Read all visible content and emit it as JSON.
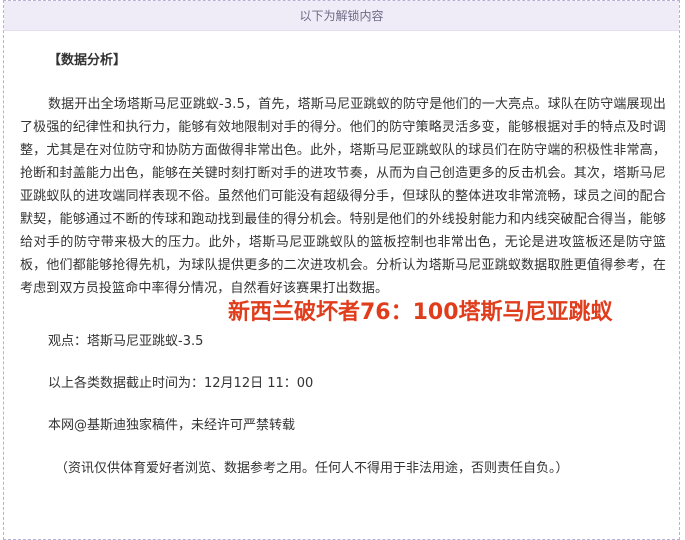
{
  "unlock_header": {
    "label": "以下为解锁内容"
  },
  "article": {
    "section_title": "【数据分析】",
    "paragraph": "数据开出全场塔斯马尼亚跳蚁-3.5，首先，塔斯马尼亚跳蚁的防守是他们的一大亮点。球队在防守端展现出了极强的纪律性和执行力，能够有效地限制对手的得分。他们的防守策略灵活多变，能够根据对手的特点及时调整，尤其是在对位防守和协防方面做得非常出色。此外，塔斯马尼亚跳蚁队的球员们在防守端的积极性非常高，抢断和封盖能力出色，能够在关键时刻打断对手的进攻节奏，从而为自己创造更多的反击机会。其次，塔斯马尼亚跳蚁队的进攻端同样表现不俗。虽然他们可能没有超级得分手，但球队的整体进攻非常流畅，球员之间的配合默契，能够通过不断的传球和跑动找到最佳的得分机会。特别是他们的外线投射能力和内线突破配合得当，能够给对手的防守带来极大的压力。此外，塔斯马尼亚跳蚁队的篮板控制也非常出色，无论是进攻篮板还是防守篮板，他们都能够抢得先机，为球队提供更多的二次进攻机会。分析认为塔斯马尼亚跳蚁数据取胜更值得参考，在考虑到双方员投篮命中率得分情况，自然看好该赛果打出数据。",
    "viewpoint": "观点：塔斯马尼亚跳蚁-3.5",
    "data_cutoff": "以上各类数据截止时间为：12月12日 11：00",
    "copyright": "本网@基斯迪独家稿件，未经许可严禁转载",
    "disclaimer": "（资讯仅供体育爱好者浏览、数据参考之用。任何人不得用于非法用途，否则责任自负。）"
  },
  "overlay": {
    "score_text": "新西兰破坏者76：100塔斯马尼亚跳蚁",
    "color": "#e03d1d"
  }
}
